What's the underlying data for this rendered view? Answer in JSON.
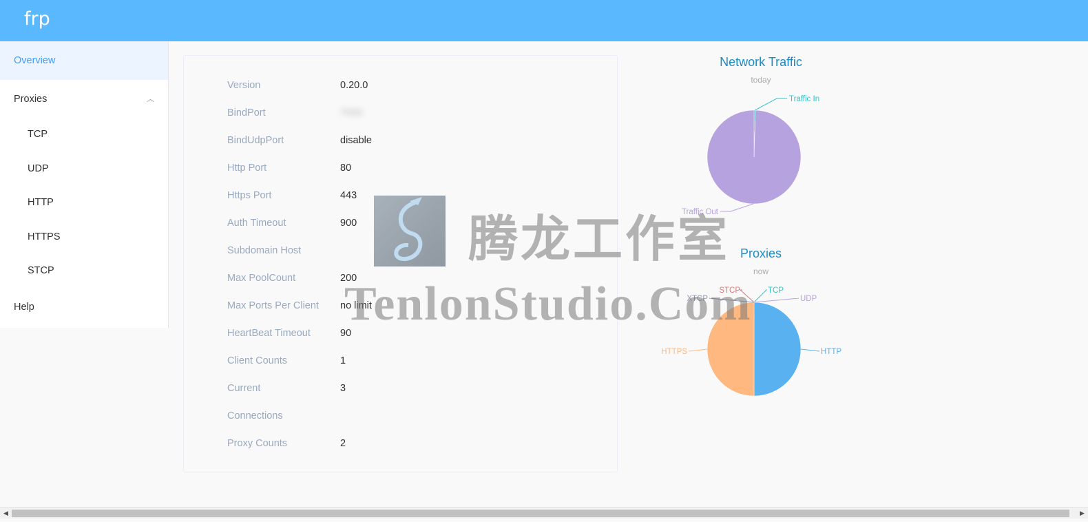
{
  "app": {
    "brand": "frp"
  },
  "sidebar": {
    "items": [
      {
        "label": "Overview",
        "active": true
      },
      {
        "label": "Proxies",
        "expanded": true
      },
      {
        "label": "TCP"
      },
      {
        "label": "UDP"
      },
      {
        "label": "HTTP"
      },
      {
        "label": "HTTPS"
      },
      {
        "label": "STCP"
      },
      {
        "label": "Help"
      }
    ]
  },
  "overview": {
    "rows": [
      {
        "label": "Version",
        "value": "0.20.0"
      },
      {
        "label": "BindPort",
        "value": "7000"
      },
      {
        "label": "BindUdpPort",
        "value": "disable"
      },
      {
        "label": "Http Port",
        "value": "80"
      },
      {
        "label": "Https Port",
        "value": "443"
      },
      {
        "label": "Auth Timeout",
        "value": "900"
      },
      {
        "label": "Subdomain Host",
        "value": ""
      },
      {
        "label": "Max PoolCount",
        "value": "200"
      },
      {
        "label": "Max Ports Per Client",
        "value": "no limit"
      },
      {
        "label": "HeartBeat Timeout",
        "value": "90"
      },
      {
        "label": "Client Counts",
        "value": "1"
      },
      {
        "label": "Current",
        "value": "3"
      },
      {
        "label": "Connections",
        "value": ""
      },
      {
        "label": "Proxy Counts",
        "value": "2"
      }
    ]
  },
  "chart_data": [
    {
      "type": "pie",
      "title": "Network Traffic",
      "subtitle": "today",
      "series": [
        {
          "name": "Traffic In",
          "value": 0.5,
          "color": "#2ec7c9"
        },
        {
          "name": "Traffic Out",
          "value": 99.5,
          "color": "#b6a2de"
        }
      ]
    },
    {
      "type": "pie",
      "title": "Proxies",
      "subtitle": "now",
      "series": [
        {
          "name": "TCP",
          "value": 0,
          "color": "#2ec7c9"
        },
        {
          "name": "UDP",
          "value": 0,
          "color": "#b6a2de"
        },
        {
          "name": "HTTP",
          "value": 1,
          "color": "#5ab1ef"
        },
        {
          "name": "HTTPS",
          "value": 1,
          "color": "#ffb980"
        },
        {
          "name": "STCP",
          "value": 0,
          "color": "#d87a80"
        },
        {
          "name": "XTCP",
          "value": 0,
          "color": "#8d98b3"
        }
      ]
    }
  ],
  "watermark": {
    "cn": "腾龙工作室",
    "en": "TenlonStudio.Com"
  },
  "colors": {
    "topbar": "#5ab8ff",
    "accent": "#409eff",
    "chart_title": "#1b8bc6"
  }
}
